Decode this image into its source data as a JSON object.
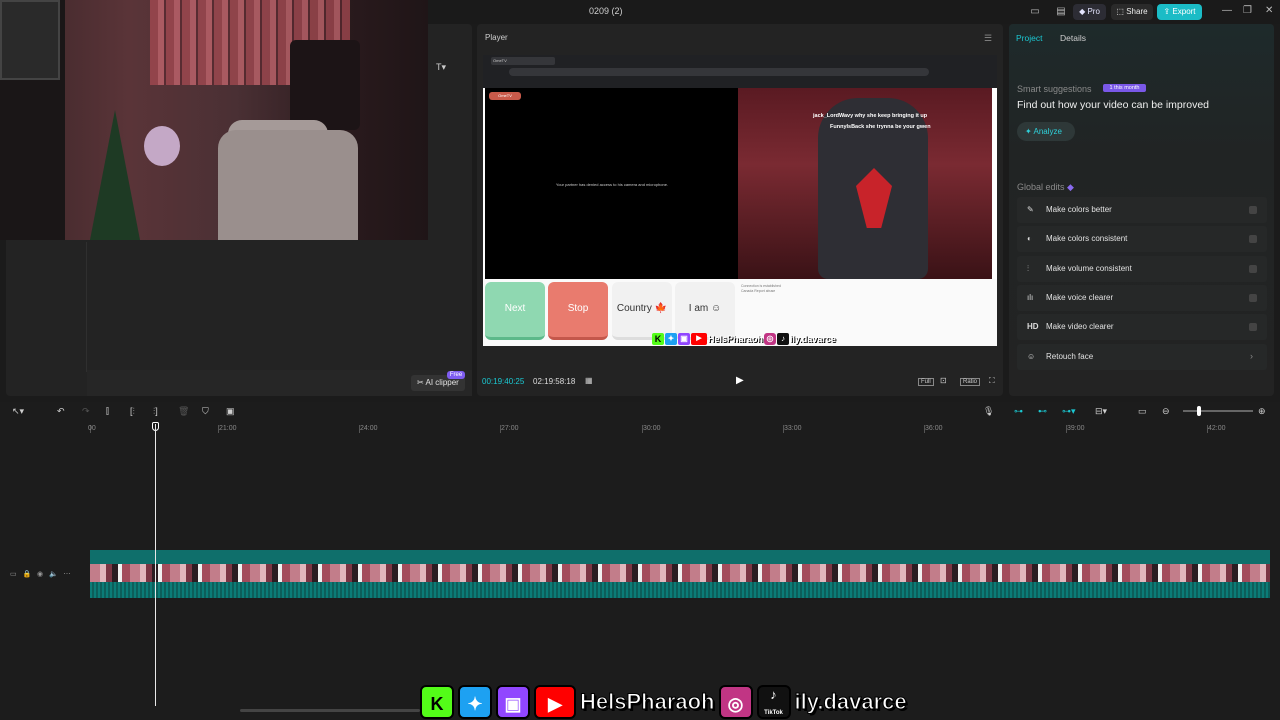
{
  "window": {
    "title": "0209 (2)",
    "pro_label": "Pro",
    "share_label": "Share",
    "export_label": "Export"
  },
  "left_panel": {
    "ai_clipper_label": "AI clipper",
    "free_badge": "Free"
  },
  "player": {
    "title": "Player",
    "current_time": "00:19:40:25",
    "total_time": "02:19:58:18",
    "full_label": "Full",
    "ratio_label": "Ratio",
    "video": {
      "no_access_msg": "Your partner has denied access to his camera and microphone.",
      "logo": "OmeTV",
      "chat_line_1": "jack_LordWavy  why she keep bringing it up",
      "chat_line_2": "FunnyIsBack  she trynna be your gwen",
      "next_label": "Next",
      "stop_label": "Stop",
      "country_label": "Country",
      "iam_label": "I am",
      "connection_msg_1": "Connection is established",
      "connection_msg_2": "Canada Report abuse",
      "overlay_handle_1": "HelsPharaoh",
      "overlay_handle_2": "ily.davarce"
    }
  },
  "right_panel": {
    "tabs": [
      "Project",
      "Details"
    ],
    "smart_suggestions_label": "Smart suggestions",
    "smart_badge": "1 this month",
    "smart_desc": "Find out how your video can be improved",
    "analyze_label": "Analyze",
    "global_edits_label": "Global edits",
    "edits": [
      {
        "label": "Make colors better",
        "icon": "wand-icon"
      },
      {
        "label": "Make colors consistent",
        "icon": "palette-icon"
      },
      {
        "label": "Make volume consistent",
        "icon": "sliders-icon"
      },
      {
        "label": "Make voice clearer",
        "icon": "waveform-icon"
      },
      {
        "label": "Make video clearer",
        "icon": "hd-icon",
        "glyph": "HD"
      },
      {
        "label": "Retouch face",
        "icon": "face-icon"
      }
    ]
  },
  "timeline": {
    "ruler": [
      "00",
      "21:00",
      "24:00",
      "27:00",
      "30:00",
      "33:00",
      "36:00",
      "39:00",
      "42:00"
    ]
  },
  "overlay": {
    "handle_1": "HelsPharaoh",
    "handle_2": "ily.davarce",
    "tiktok_label": "TikTok"
  },
  "colors": {
    "accent": "#1bc8d2",
    "pro": "#7a58e8",
    "next_btn": "#8fd8b1",
    "stop_btn": "#e97b6e"
  }
}
